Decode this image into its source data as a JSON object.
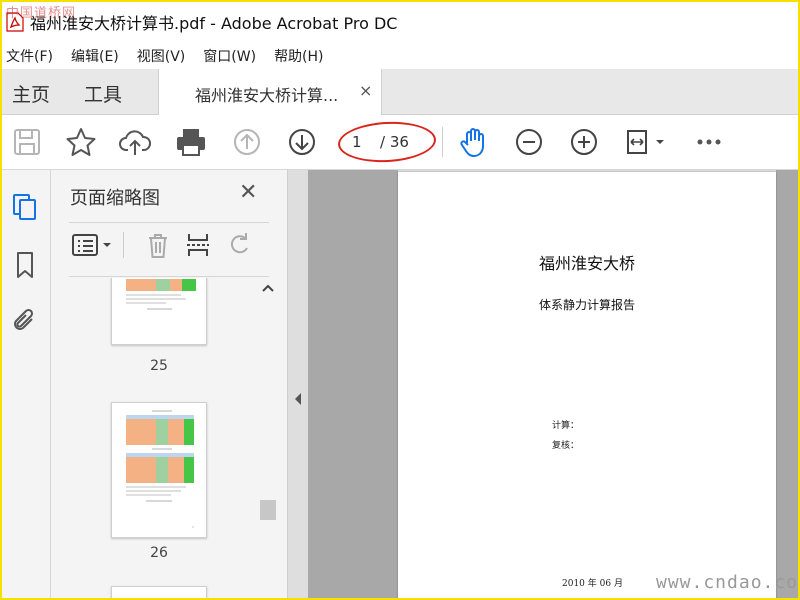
{
  "window": {
    "title": "福州淮安大桥计算书.pdf - Adobe Acrobat Pro DC"
  },
  "watermarks": {
    "top": "中国道桥网",
    "bottom": "www.cndao.co"
  },
  "menu": [
    "文件(F)",
    "编辑(E)",
    "视图(V)",
    "窗口(W)",
    "帮助(H)"
  ],
  "tabs": {
    "home": "主页",
    "tools": "工具",
    "document": "福州淮安大桥计算...",
    "close": "×"
  },
  "toolbar": {
    "page_current": "1",
    "page_total": "/ 36",
    "accent": "#1473e6",
    "highlight": "#d9251c"
  },
  "panel": {
    "title": "页面缩略图",
    "close": "✕",
    "thumb_labels": [
      "25",
      "26"
    ]
  },
  "document": {
    "title": "福州淮安大桥",
    "subtitle": "体系静力计算报告",
    "field_calc": "计算：",
    "field_review": "复核：",
    "date": "2010 年 06 月"
  }
}
